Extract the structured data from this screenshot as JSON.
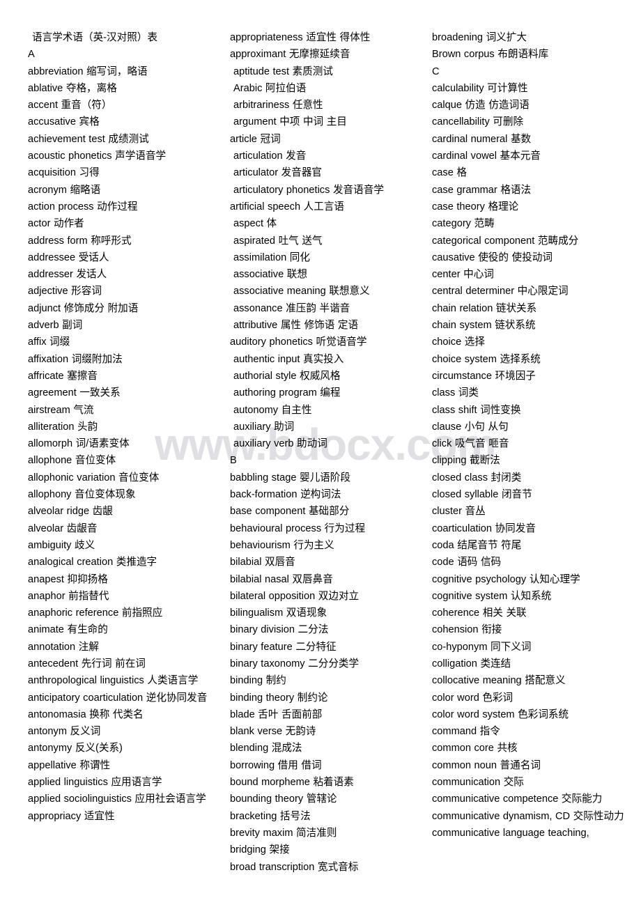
{
  "document": {
    "title": "语言学术语（英-汉对照）表",
    "watermark": "www.bdocx.com",
    "watermark_color": "#dfdfe4",
    "text_color": "#000000",
    "background_color": "#ffffff",
    "column_count": 3
  },
  "columns": [
    {
      "id": "col-1",
      "entries": [
        {
          "text": "语言学术语（英-汉对照）表",
          "style": "title"
        },
        {
          "text": "A",
          "style": "letter"
        },
        {
          "text": "abbreviation  缩写词，略语",
          "style": "noj"
        },
        {
          "text": "ablative  夺格，离格",
          "style": "noj"
        },
        {
          "text": "accent  重音（符）",
          "style": "noj"
        },
        {
          "text": "accusative  宾格",
          "style": "noj"
        },
        {
          "text": "achievement test  成绩测试",
          "style": "noj"
        },
        {
          "text": "acoustic phonetics  声学语音学",
          "style": "noj"
        },
        {
          "text": "acquisition  习得",
          "style": "noj"
        },
        {
          "text": "acronym  缩略语",
          "style": "noj"
        },
        {
          "text": "action process  动作过程",
          "style": "noj"
        },
        {
          "text": "actor  动作者",
          "style": "noj"
        },
        {
          "text": "address form  称呼形式",
          "style": "noj"
        },
        {
          "text": "addressee  受话人",
          "style": "noj"
        },
        {
          "text": "addresser  发话人",
          "style": "noj"
        },
        {
          "text": "adjective  形容词",
          "style": "noj"
        },
        {
          "text": "adjunct  修饰成分  附加语",
          "style": "noj"
        },
        {
          "text": "adverb  副词",
          "style": "noj"
        },
        {
          "text": "affix  词缀",
          "style": "noj"
        },
        {
          "text": "affixation 词缀附加法",
          "style": "noj"
        },
        {
          "text": "affricate  塞擦音",
          "style": "noj"
        },
        {
          "text": "agreement  一致关系",
          "style": "noj"
        },
        {
          "text": "airstream  气流",
          "style": "noj"
        },
        {
          "text": "alliteration  头韵",
          "style": "noj"
        },
        {
          "text": "allomorph  词/语素变体",
          "style": "noj"
        },
        {
          "text": "allophone  音位变体",
          "style": "noj"
        },
        {
          "text": "allophonic variation  音位变体",
          "style": "noj"
        },
        {
          "text": "allophony 音位变体现象",
          "style": "noj"
        },
        {
          "text": "alveolar ridge  齿龈",
          "style": "noj"
        },
        {
          "text": "alveolar  齿龈音",
          "style": "noj"
        },
        {
          "text": "ambiguity  歧义",
          "style": "noj"
        },
        {
          "text": "analogical creation  类推造字",
          "style": "noj"
        },
        {
          "text": "anapest 抑抑扬格",
          "style": "noj"
        },
        {
          "text": "anaphor  前指替代",
          "style": "noj"
        },
        {
          "text": "anaphoric reference  前指照应",
          "style": "noj"
        },
        {
          "text": "animate  有生命的",
          "style": "noj"
        },
        {
          "text": "annotation  注解",
          "style": "noj"
        },
        {
          "text": "antecedent  先行词  前在词",
          "style": "noj"
        },
        {
          "text": "anthropological linguistics  人类语言学",
          "style": "justify"
        },
        {
          "text": "anticipatory coarticulation  逆化协同发音",
          "style": "justify"
        },
        {
          "text": "antonomasia  换称  代类名",
          "style": "noj"
        },
        {
          "text": "antonym  反义词",
          "style": "noj"
        },
        {
          "text": "antonymy  反义(关系)",
          "style": "noj"
        },
        {
          "text": "appellative  称谓性",
          "style": "noj"
        },
        {
          "text": "applied linguistics  应用语言学",
          "style": "noj"
        },
        {
          "text": "applied sociolinguistics  应用社会语言学",
          "style": "justify"
        },
        {
          "text": "appropriacy  适宜性",
          "style": "noj"
        }
      ]
    },
    {
      "id": "col-2",
      "entries": [
        {
          "text": "appropriateness  适宜性  得体性",
          "style": "noj"
        },
        {
          "text": "approximant  无摩擦延续音",
          "style": "noj"
        },
        {
          "text": "aptitude test  素质测试",
          "style": "indent"
        },
        {
          "text": "Arabic  阿拉伯语",
          "style": "indent"
        },
        {
          "text": "arbitrariness  任意性",
          "style": "indent"
        },
        {
          "text": "argument  中项  中词  主目",
          "style": "indent"
        },
        {
          "text": "article  冠词",
          "style": "noj"
        },
        {
          "text": "articulation  发音",
          "style": "indent"
        },
        {
          "text": "articulator  发音器官",
          "style": "indent"
        },
        {
          "text": "articulatory phonetics  发音语音学",
          "style": "indent"
        },
        {
          "text": "artificial speech  人工言语",
          "style": "noj"
        },
        {
          "text": "aspect  体",
          "style": "indent"
        },
        {
          "text": "aspirated  吐气  送气",
          "style": "indent"
        },
        {
          "text": "assimilation  同化",
          "style": "indent"
        },
        {
          "text": "associative  联想",
          "style": "indent"
        },
        {
          "text": "associative meaning  联想意义",
          "style": "indent"
        },
        {
          "text": "assonance 准压韵  半谐音",
          "style": "indent"
        },
        {
          "text": "attributive  属性  修饰语  定语",
          "style": "indent"
        },
        {
          "text": "auditory phonetics 听觉语音学",
          "style": "noj"
        },
        {
          "text": "authentic input  真实投入",
          "style": "indent"
        },
        {
          "text": "authorial style  权威风格",
          "style": "indent"
        },
        {
          "text": "authoring program  编程",
          "style": "indent"
        },
        {
          "text": "autonomy  自主性",
          "style": "indent"
        },
        {
          "text": "auxiliary  助词",
          "style": "indent"
        },
        {
          "text": "auxiliary verb  助动词",
          "style": "indent"
        },
        {
          "text": "B",
          "style": "letter"
        },
        {
          "text": "babbling stage  婴儿语阶段",
          "style": "noj"
        },
        {
          "text": "back-formation  逆构词法",
          "style": "noj"
        },
        {
          "text": "base component  基础部分",
          "style": "noj"
        },
        {
          "text": "behavioural process  行为过程",
          "style": "noj"
        },
        {
          "text": "behaviourism  行为主义",
          "style": "noj"
        },
        {
          "text": "bilabial  双唇音",
          "style": "noj"
        },
        {
          "text": "bilabial nasal  双唇鼻音",
          "style": "noj"
        },
        {
          "text": "bilateral opposition  双边对立",
          "style": "noj"
        },
        {
          "text": "bilingualism  双语现象",
          "style": "noj"
        },
        {
          "text": "binary division  二分法",
          "style": "noj"
        },
        {
          "text": "binary feature  二分特征",
          "style": "noj"
        },
        {
          "text": "binary taxonomy  二分分类学",
          "style": "noj"
        },
        {
          "text": "binding  制约",
          "style": "noj"
        },
        {
          "text": "binding theory  制约论",
          "style": "noj"
        },
        {
          "text": "blade  舌叶  舌面前部",
          "style": "noj"
        },
        {
          "text": "blank verse  无韵诗",
          "style": "noj"
        },
        {
          "text": "blending  混成法",
          "style": "noj"
        },
        {
          "text": "borrowing  借用  借词",
          "style": "noj"
        },
        {
          "text": "bound morpheme  粘着语素",
          "style": "noj"
        },
        {
          "text": "bounding theory  管辖论",
          "style": "noj"
        },
        {
          "text": "bracketing  括号法",
          "style": "noj"
        },
        {
          "text": "brevity maxim  简洁准则",
          "style": "noj"
        },
        {
          "text": "bridging  架接",
          "style": "noj"
        },
        {
          "text": "broad transcription  宽式音标",
          "style": "noj"
        }
      ]
    },
    {
      "id": "col-3",
      "entries": [
        {
          "text": "broadening  词义扩大",
          "style": "noj"
        },
        {
          "text": "Brown corpus  布朗语料库",
          "style": "noj"
        },
        {
          "text": "C",
          "style": "letter"
        },
        {
          "text": "calculability  可计算性",
          "style": "noj"
        },
        {
          "text": "calque  仿造  仿造词语",
          "style": "noj"
        },
        {
          "text": "cancellability  可删除",
          "style": "noj"
        },
        {
          "text": "cardinal numeral  基数",
          "style": "noj"
        },
        {
          "text": "cardinal vowel  基本元音",
          "style": "noj"
        },
        {
          "text": "case  格",
          "style": "noj"
        },
        {
          "text": "case grammar 格语法",
          "style": "noj"
        },
        {
          "text": "case theory 格理论",
          "style": "noj"
        },
        {
          "text": "category  范畴",
          "style": "noj"
        },
        {
          "text": "categorical component  范畴成分",
          "style": "noj"
        },
        {
          "text": "causative  使役的  使投动词",
          "style": "noj"
        },
        {
          "text": "center  中心词",
          "style": "noj"
        },
        {
          "text": "central determiner  中心限定词",
          "style": "noj"
        },
        {
          "text": "chain relation  链状关系",
          "style": "noj"
        },
        {
          "text": "chain system  链状系统",
          "style": "noj"
        },
        {
          "text": "choice  选择",
          "style": "noj"
        },
        {
          "text": "choice system  选择系统",
          "style": "noj"
        },
        {
          "text": "circumstance  环境因子",
          "style": "noj"
        },
        {
          "text": "class  词类",
          "style": "noj"
        },
        {
          "text": "class shift  词性变换",
          "style": "noj"
        },
        {
          "text": "clause  小句  从句",
          "style": "noj"
        },
        {
          "text": "click  吸气音  咂音",
          "style": "noj"
        },
        {
          "text": "clipping  截断法",
          "style": "noj"
        },
        {
          "text": "closed class  封闭类",
          "style": "noj"
        },
        {
          "text": "closed syllable  闭音节",
          "style": "noj"
        },
        {
          "text": "cluster  音丛",
          "style": "noj"
        },
        {
          "text": "coarticulation  协同发音",
          "style": "noj"
        },
        {
          "text": "coda  结尾音节  符尾",
          "style": "noj"
        },
        {
          "text": "code  语码  信码",
          "style": "noj"
        },
        {
          "text": "cognitive psychology  认知心理学",
          "style": "noj"
        },
        {
          "text": "cognitive system  认知系统",
          "style": "noj"
        },
        {
          "text": "coherence  相关  关联",
          "style": "noj"
        },
        {
          "text": "cohension  衔接",
          "style": "noj"
        },
        {
          "text": "co-hyponym  同下义词",
          "style": "noj"
        },
        {
          "text": "colligation  类连结",
          "style": "noj"
        },
        {
          "text": "collocative meaning  搭配意义",
          "style": "noj"
        },
        {
          "text": "color word  色彩词",
          "style": "noj"
        },
        {
          "text": "color word system  色彩词系统",
          "style": "noj"
        },
        {
          "text": "command  指令",
          "style": "noj"
        },
        {
          "text": "common core  共核",
          "style": "noj"
        },
        {
          "text": "common noun  普通名词",
          "style": "noj"
        },
        {
          "text": "communication  交际",
          "style": "noj"
        },
        {
          "text": "communicative competence  交际能力",
          "style": "justify"
        },
        {
          "text": "communicative dynamism, CD  交际性动力",
          "style": "justify"
        },
        {
          "text": "communicative language teaching,",
          "style": "justify"
        }
      ]
    }
  ]
}
